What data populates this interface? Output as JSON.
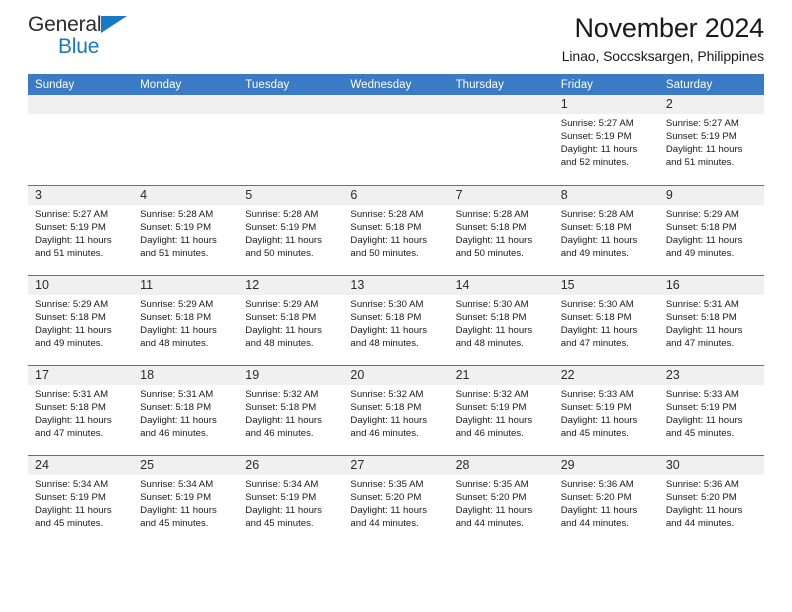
{
  "logo": {
    "word1": "General",
    "word2": "Blue",
    "mark": "triangle-mark",
    "accent_color": "#1879c4"
  },
  "header": {
    "title": "November 2024",
    "subtitle": "Linao, Soccsksargen, Philippines"
  },
  "theme": {
    "header_blue": "#3b7ac4",
    "daynum_gray": "#f0f0f0"
  },
  "weekdays": [
    "Sunday",
    "Monday",
    "Tuesday",
    "Wednesday",
    "Thursday",
    "Friday",
    "Saturday"
  ],
  "weeks": [
    [
      {
        "day": "",
        "sunrise": "",
        "sunset": "",
        "daylight": ""
      },
      {
        "day": "",
        "sunrise": "",
        "sunset": "",
        "daylight": ""
      },
      {
        "day": "",
        "sunrise": "",
        "sunset": "",
        "daylight": ""
      },
      {
        "day": "",
        "sunrise": "",
        "sunset": "",
        "daylight": ""
      },
      {
        "day": "",
        "sunrise": "",
        "sunset": "",
        "daylight": ""
      },
      {
        "day": "1",
        "sunrise": "Sunrise: 5:27 AM",
        "sunset": "Sunset: 5:19 PM",
        "daylight": "Daylight: 11 hours and 52 minutes."
      },
      {
        "day": "2",
        "sunrise": "Sunrise: 5:27 AM",
        "sunset": "Sunset: 5:19 PM",
        "daylight": "Daylight: 11 hours and 51 minutes."
      }
    ],
    [
      {
        "day": "3",
        "sunrise": "Sunrise: 5:27 AM",
        "sunset": "Sunset: 5:19 PM",
        "daylight": "Daylight: 11 hours and 51 minutes."
      },
      {
        "day": "4",
        "sunrise": "Sunrise: 5:28 AM",
        "sunset": "Sunset: 5:19 PM",
        "daylight": "Daylight: 11 hours and 51 minutes."
      },
      {
        "day": "5",
        "sunrise": "Sunrise: 5:28 AM",
        "sunset": "Sunset: 5:19 PM",
        "daylight": "Daylight: 11 hours and 50 minutes."
      },
      {
        "day": "6",
        "sunrise": "Sunrise: 5:28 AM",
        "sunset": "Sunset: 5:18 PM",
        "daylight": "Daylight: 11 hours and 50 minutes."
      },
      {
        "day": "7",
        "sunrise": "Sunrise: 5:28 AM",
        "sunset": "Sunset: 5:18 PM",
        "daylight": "Daylight: 11 hours and 50 minutes."
      },
      {
        "day": "8",
        "sunrise": "Sunrise: 5:28 AM",
        "sunset": "Sunset: 5:18 PM",
        "daylight": "Daylight: 11 hours and 49 minutes."
      },
      {
        "day": "9",
        "sunrise": "Sunrise: 5:29 AM",
        "sunset": "Sunset: 5:18 PM",
        "daylight": "Daylight: 11 hours and 49 minutes."
      }
    ],
    [
      {
        "day": "10",
        "sunrise": "Sunrise: 5:29 AM",
        "sunset": "Sunset: 5:18 PM",
        "daylight": "Daylight: 11 hours and 49 minutes."
      },
      {
        "day": "11",
        "sunrise": "Sunrise: 5:29 AM",
        "sunset": "Sunset: 5:18 PM",
        "daylight": "Daylight: 11 hours and 48 minutes."
      },
      {
        "day": "12",
        "sunrise": "Sunrise: 5:29 AM",
        "sunset": "Sunset: 5:18 PM",
        "daylight": "Daylight: 11 hours and 48 minutes."
      },
      {
        "day": "13",
        "sunrise": "Sunrise: 5:30 AM",
        "sunset": "Sunset: 5:18 PM",
        "daylight": "Daylight: 11 hours and 48 minutes."
      },
      {
        "day": "14",
        "sunrise": "Sunrise: 5:30 AM",
        "sunset": "Sunset: 5:18 PM",
        "daylight": "Daylight: 11 hours and 48 minutes."
      },
      {
        "day": "15",
        "sunrise": "Sunrise: 5:30 AM",
        "sunset": "Sunset: 5:18 PM",
        "daylight": "Daylight: 11 hours and 47 minutes."
      },
      {
        "day": "16",
        "sunrise": "Sunrise: 5:31 AM",
        "sunset": "Sunset: 5:18 PM",
        "daylight": "Daylight: 11 hours and 47 minutes."
      }
    ],
    [
      {
        "day": "17",
        "sunrise": "Sunrise: 5:31 AM",
        "sunset": "Sunset: 5:18 PM",
        "daylight": "Daylight: 11 hours and 47 minutes."
      },
      {
        "day": "18",
        "sunrise": "Sunrise: 5:31 AM",
        "sunset": "Sunset: 5:18 PM",
        "daylight": "Daylight: 11 hours and 46 minutes."
      },
      {
        "day": "19",
        "sunrise": "Sunrise: 5:32 AM",
        "sunset": "Sunset: 5:18 PM",
        "daylight": "Daylight: 11 hours and 46 minutes."
      },
      {
        "day": "20",
        "sunrise": "Sunrise: 5:32 AM",
        "sunset": "Sunset: 5:18 PM",
        "daylight": "Daylight: 11 hours and 46 minutes."
      },
      {
        "day": "21",
        "sunrise": "Sunrise: 5:32 AM",
        "sunset": "Sunset: 5:19 PM",
        "daylight": "Daylight: 11 hours and 46 minutes."
      },
      {
        "day": "22",
        "sunrise": "Sunrise: 5:33 AM",
        "sunset": "Sunset: 5:19 PM",
        "daylight": "Daylight: 11 hours and 45 minutes."
      },
      {
        "day": "23",
        "sunrise": "Sunrise: 5:33 AM",
        "sunset": "Sunset: 5:19 PM",
        "daylight": "Daylight: 11 hours and 45 minutes."
      }
    ],
    [
      {
        "day": "24",
        "sunrise": "Sunrise: 5:34 AM",
        "sunset": "Sunset: 5:19 PM",
        "daylight": "Daylight: 11 hours and 45 minutes."
      },
      {
        "day": "25",
        "sunrise": "Sunrise: 5:34 AM",
        "sunset": "Sunset: 5:19 PM",
        "daylight": "Daylight: 11 hours and 45 minutes."
      },
      {
        "day": "26",
        "sunrise": "Sunrise: 5:34 AM",
        "sunset": "Sunset: 5:19 PM",
        "daylight": "Daylight: 11 hours and 45 minutes."
      },
      {
        "day": "27",
        "sunrise": "Sunrise: 5:35 AM",
        "sunset": "Sunset: 5:20 PM",
        "daylight": "Daylight: 11 hours and 44 minutes."
      },
      {
        "day": "28",
        "sunrise": "Sunrise: 5:35 AM",
        "sunset": "Sunset: 5:20 PM",
        "daylight": "Daylight: 11 hours and 44 minutes."
      },
      {
        "day": "29",
        "sunrise": "Sunrise: 5:36 AM",
        "sunset": "Sunset: 5:20 PM",
        "daylight": "Daylight: 11 hours and 44 minutes."
      },
      {
        "day": "30",
        "sunrise": "Sunrise: 5:36 AM",
        "sunset": "Sunset: 5:20 PM",
        "daylight": "Daylight: 11 hours and 44 minutes."
      }
    ]
  ]
}
